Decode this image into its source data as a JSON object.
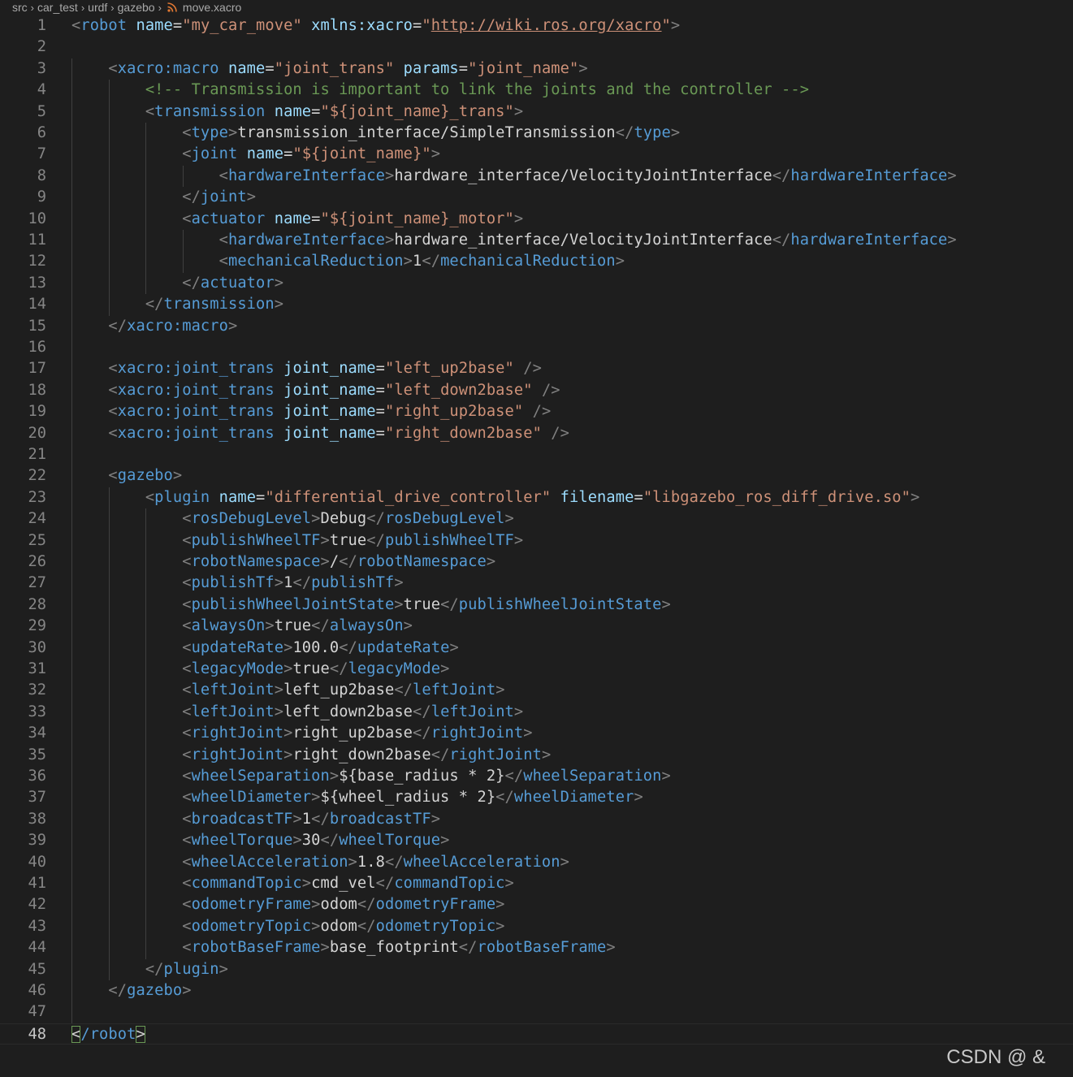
{
  "breadcrumb": {
    "items": [
      "src",
      "car_test",
      "urdf",
      "gazebo"
    ],
    "file": "move.xacro"
  },
  "editor": {
    "active_line": 48,
    "lines": [
      [
        [
          "p",
          "<"
        ],
        [
          "t",
          "robot"
        ],
        [
          "x",
          " "
        ],
        [
          "a",
          "name"
        ],
        [
          "x",
          "="
        ],
        [
          "s",
          "\"my_car_move\""
        ],
        [
          "x",
          " "
        ],
        [
          "a",
          "xmlns:xacro"
        ],
        [
          "x",
          "="
        ],
        [
          "s",
          "\""
        ],
        [
          "u",
          "http://wiki.ros.org/xacro"
        ],
        [
          "s",
          "\""
        ],
        [
          "p",
          ">"
        ]
      ],
      [],
      [
        [
          "x",
          "    "
        ],
        [
          "p",
          "<"
        ],
        [
          "t",
          "xacro:macro"
        ],
        [
          "x",
          " "
        ],
        [
          "a",
          "name"
        ],
        [
          "x",
          "="
        ],
        [
          "s",
          "\"joint_trans\""
        ],
        [
          "x",
          " "
        ],
        [
          "a",
          "params"
        ],
        [
          "x",
          "="
        ],
        [
          "s",
          "\"joint_name\""
        ],
        [
          "p",
          ">"
        ]
      ],
      [
        [
          "x",
          "        "
        ],
        [
          "c",
          "<!-- Transmission is important to link the joints and the controller -->"
        ]
      ],
      [
        [
          "x",
          "        "
        ],
        [
          "p",
          "<"
        ],
        [
          "t",
          "transmission"
        ],
        [
          "x",
          " "
        ],
        [
          "a",
          "name"
        ],
        [
          "x",
          "="
        ],
        [
          "s",
          "\"${joint_name}_trans\""
        ],
        [
          "p",
          ">"
        ]
      ],
      [
        [
          "x",
          "            "
        ],
        [
          "p",
          "<"
        ],
        [
          "t",
          "type"
        ],
        [
          "p",
          ">"
        ],
        [
          "x",
          "transmission_interface/SimpleTransmission"
        ],
        [
          "p",
          "</"
        ],
        [
          "t",
          "type"
        ],
        [
          "p",
          ">"
        ]
      ],
      [
        [
          "x",
          "            "
        ],
        [
          "p",
          "<"
        ],
        [
          "t",
          "joint"
        ],
        [
          "x",
          " "
        ],
        [
          "a",
          "name"
        ],
        [
          "x",
          "="
        ],
        [
          "s",
          "\"${joint_name}\""
        ],
        [
          "p",
          ">"
        ]
      ],
      [
        [
          "x",
          "                "
        ],
        [
          "p",
          "<"
        ],
        [
          "t",
          "hardwareInterface"
        ],
        [
          "p",
          ">"
        ],
        [
          "x",
          "hardware_interface/VelocityJointInterface"
        ],
        [
          "p",
          "</"
        ],
        [
          "t",
          "hardwareInterface"
        ],
        [
          "p",
          ">"
        ]
      ],
      [
        [
          "x",
          "            "
        ],
        [
          "p",
          "</"
        ],
        [
          "t",
          "joint"
        ],
        [
          "p",
          ">"
        ]
      ],
      [
        [
          "x",
          "            "
        ],
        [
          "p",
          "<"
        ],
        [
          "t",
          "actuator"
        ],
        [
          "x",
          " "
        ],
        [
          "a",
          "name"
        ],
        [
          "x",
          "="
        ],
        [
          "s",
          "\"${joint_name}_motor\""
        ],
        [
          "p",
          ">"
        ]
      ],
      [
        [
          "x",
          "                "
        ],
        [
          "p",
          "<"
        ],
        [
          "t",
          "hardwareInterface"
        ],
        [
          "p",
          ">"
        ],
        [
          "x",
          "hardware_interface/VelocityJointInterface"
        ],
        [
          "p",
          "</"
        ],
        [
          "t",
          "hardwareInterface"
        ],
        [
          "p",
          ">"
        ]
      ],
      [
        [
          "x",
          "                "
        ],
        [
          "p",
          "<"
        ],
        [
          "t",
          "mechanicalReduction"
        ],
        [
          "p",
          ">"
        ],
        [
          "x",
          "1"
        ],
        [
          "p",
          "</"
        ],
        [
          "t",
          "mechanicalReduction"
        ],
        [
          "p",
          ">"
        ]
      ],
      [
        [
          "x",
          "            "
        ],
        [
          "p",
          "</"
        ],
        [
          "t",
          "actuator"
        ],
        [
          "p",
          ">"
        ]
      ],
      [
        [
          "x",
          "        "
        ],
        [
          "p",
          "</"
        ],
        [
          "t",
          "transmission"
        ],
        [
          "p",
          ">"
        ]
      ],
      [
        [
          "x",
          "    "
        ],
        [
          "p",
          "</"
        ],
        [
          "t",
          "xacro:macro"
        ],
        [
          "p",
          ">"
        ]
      ],
      [],
      [
        [
          "x",
          "    "
        ],
        [
          "p",
          "<"
        ],
        [
          "t",
          "xacro:joint_trans"
        ],
        [
          "x",
          " "
        ],
        [
          "a",
          "joint_name"
        ],
        [
          "x",
          "="
        ],
        [
          "s",
          "\"left_up2base\""
        ],
        [
          "x",
          " "
        ],
        [
          "p",
          "/>"
        ]
      ],
      [
        [
          "x",
          "    "
        ],
        [
          "p",
          "<"
        ],
        [
          "t",
          "xacro:joint_trans"
        ],
        [
          "x",
          " "
        ],
        [
          "a",
          "joint_name"
        ],
        [
          "x",
          "="
        ],
        [
          "s",
          "\"left_down2base\""
        ],
        [
          "x",
          " "
        ],
        [
          "p",
          "/>"
        ]
      ],
      [
        [
          "x",
          "    "
        ],
        [
          "p",
          "<"
        ],
        [
          "t",
          "xacro:joint_trans"
        ],
        [
          "x",
          " "
        ],
        [
          "a",
          "joint_name"
        ],
        [
          "x",
          "="
        ],
        [
          "s",
          "\"right_up2base\""
        ],
        [
          "x",
          " "
        ],
        [
          "p",
          "/>"
        ]
      ],
      [
        [
          "x",
          "    "
        ],
        [
          "p",
          "<"
        ],
        [
          "t",
          "xacro:joint_trans"
        ],
        [
          "x",
          " "
        ],
        [
          "a",
          "joint_name"
        ],
        [
          "x",
          "="
        ],
        [
          "s",
          "\"right_down2base\""
        ],
        [
          "x",
          " "
        ],
        [
          "p",
          "/>"
        ]
      ],
      [],
      [
        [
          "x",
          "    "
        ],
        [
          "p",
          "<"
        ],
        [
          "t",
          "gazebo"
        ],
        [
          "p",
          ">"
        ]
      ],
      [
        [
          "x",
          "        "
        ],
        [
          "p",
          "<"
        ],
        [
          "t",
          "plugin"
        ],
        [
          "x",
          " "
        ],
        [
          "a",
          "name"
        ],
        [
          "x",
          "="
        ],
        [
          "s",
          "\"differential_drive_controller\""
        ],
        [
          "x",
          " "
        ],
        [
          "a",
          "filename"
        ],
        [
          "x",
          "="
        ],
        [
          "s",
          "\"libgazebo_ros_diff_drive.so\""
        ],
        [
          "p",
          ">"
        ]
      ],
      [
        [
          "x",
          "            "
        ],
        [
          "p",
          "<"
        ],
        [
          "t",
          "rosDebugLevel"
        ],
        [
          "p",
          ">"
        ],
        [
          "x",
          "Debug"
        ],
        [
          "p",
          "</"
        ],
        [
          "t",
          "rosDebugLevel"
        ],
        [
          "p",
          ">"
        ]
      ],
      [
        [
          "x",
          "            "
        ],
        [
          "p",
          "<"
        ],
        [
          "t",
          "publishWheelTF"
        ],
        [
          "p",
          ">"
        ],
        [
          "x",
          "true"
        ],
        [
          "p",
          "</"
        ],
        [
          "t",
          "publishWheelTF"
        ],
        [
          "p",
          ">"
        ]
      ],
      [
        [
          "x",
          "            "
        ],
        [
          "p",
          "<"
        ],
        [
          "t",
          "robotNamespace"
        ],
        [
          "p",
          ">"
        ],
        [
          "x",
          "/"
        ],
        [
          "p",
          "</"
        ],
        [
          "t",
          "robotNamespace"
        ],
        [
          "p",
          ">"
        ]
      ],
      [
        [
          "x",
          "            "
        ],
        [
          "p",
          "<"
        ],
        [
          "t",
          "publishTf"
        ],
        [
          "p",
          ">"
        ],
        [
          "x",
          "1"
        ],
        [
          "p",
          "</"
        ],
        [
          "t",
          "publishTf"
        ],
        [
          "p",
          ">"
        ]
      ],
      [
        [
          "x",
          "            "
        ],
        [
          "p",
          "<"
        ],
        [
          "t",
          "publishWheelJointState"
        ],
        [
          "p",
          ">"
        ],
        [
          "x",
          "true"
        ],
        [
          "p",
          "</"
        ],
        [
          "t",
          "publishWheelJointState"
        ],
        [
          "p",
          ">"
        ]
      ],
      [
        [
          "x",
          "            "
        ],
        [
          "p",
          "<"
        ],
        [
          "t",
          "alwaysOn"
        ],
        [
          "p",
          ">"
        ],
        [
          "x",
          "true"
        ],
        [
          "p",
          "</"
        ],
        [
          "t",
          "alwaysOn"
        ],
        [
          "p",
          ">"
        ]
      ],
      [
        [
          "x",
          "            "
        ],
        [
          "p",
          "<"
        ],
        [
          "t",
          "updateRate"
        ],
        [
          "p",
          ">"
        ],
        [
          "x",
          "100.0"
        ],
        [
          "p",
          "</"
        ],
        [
          "t",
          "updateRate"
        ],
        [
          "p",
          ">"
        ]
      ],
      [
        [
          "x",
          "            "
        ],
        [
          "p",
          "<"
        ],
        [
          "t",
          "legacyMode"
        ],
        [
          "p",
          ">"
        ],
        [
          "x",
          "true"
        ],
        [
          "p",
          "</"
        ],
        [
          "t",
          "legacyMode"
        ],
        [
          "p",
          ">"
        ]
      ],
      [
        [
          "x",
          "            "
        ],
        [
          "p",
          "<"
        ],
        [
          "t",
          "leftJoint"
        ],
        [
          "p",
          ">"
        ],
        [
          "x",
          "left_up2base"
        ],
        [
          "p",
          "</"
        ],
        [
          "t",
          "leftJoint"
        ],
        [
          "p",
          ">"
        ]
      ],
      [
        [
          "x",
          "            "
        ],
        [
          "p",
          "<"
        ],
        [
          "t",
          "leftJoint"
        ],
        [
          "p",
          ">"
        ],
        [
          "x",
          "left_down2base"
        ],
        [
          "p",
          "</"
        ],
        [
          "t",
          "leftJoint"
        ],
        [
          "p",
          ">"
        ]
      ],
      [
        [
          "x",
          "            "
        ],
        [
          "p",
          "<"
        ],
        [
          "t",
          "rightJoint"
        ],
        [
          "p",
          ">"
        ],
        [
          "x",
          "right_up2base"
        ],
        [
          "p",
          "</"
        ],
        [
          "t",
          "rightJoint"
        ],
        [
          "p",
          ">"
        ]
      ],
      [
        [
          "x",
          "            "
        ],
        [
          "p",
          "<"
        ],
        [
          "t",
          "rightJoint"
        ],
        [
          "p",
          ">"
        ],
        [
          "x",
          "right_down2base"
        ],
        [
          "p",
          "</"
        ],
        [
          "t",
          "rightJoint"
        ],
        [
          "p",
          ">"
        ]
      ],
      [
        [
          "x",
          "            "
        ],
        [
          "p",
          "<"
        ],
        [
          "t",
          "wheelSeparation"
        ],
        [
          "p",
          ">"
        ],
        [
          "x",
          "${base_radius * 2}"
        ],
        [
          "p",
          "</"
        ],
        [
          "t",
          "wheelSeparation"
        ],
        [
          "p",
          ">"
        ]
      ],
      [
        [
          "x",
          "            "
        ],
        [
          "p",
          "<"
        ],
        [
          "t",
          "wheelDiameter"
        ],
        [
          "p",
          ">"
        ],
        [
          "x",
          "${wheel_radius * 2}"
        ],
        [
          "p",
          "</"
        ],
        [
          "t",
          "wheelDiameter"
        ],
        [
          "p",
          ">"
        ]
      ],
      [
        [
          "x",
          "            "
        ],
        [
          "p",
          "<"
        ],
        [
          "t",
          "broadcastTF"
        ],
        [
          "p",
          ">"
        ],
        [
          "x",
          "1"
        ],
        [
          "p",
          "</"
        ],
        [
          "t",
          "broadcastTF"
        ],
        [
          "p",
          ">"
        ]
      ],
      [
        [
          "x",
          "            "
        ],
        [
          "p",
          "<"
        ],
        [
          "t",
          "wheelTorque"
        ],
        [
          "p",
          ">"
        ],
        [
          "x",
          "30"
        ],
        [
          "p",
          "</"
        ],
        [
          "t",
          "wheelTorque"
        ],
        [
          "p",
          ">"
        ]
      ],
      [
        [
          "x",
          "            "
        ],
        [
          "p",
          "<"
        ],
        [
          "t",
          "wheelAcceleration"
        ],
        [
          "p",
          ">"
        ],
        [
          "x",
          "1.8"
        ],
        [
          "p",
          "</"
        ],
        [
          "t",
          "wheelAcceleration"
        ],
        [
          "p",
          ">"
        ]
      ],
      [
        [
          "x",
          "            "
        ],
        [
          "p",
          "<"
        ],
        [
          "t",
          "commandTopic"
        ],
        [
          "p",
          ">"
        ],
        [
          "x",
          "cmd_vel"
        ],
        [
          "p",
          "</"
        ],
        [
          "t",
          "commandTopic"
        ],
        [
          "p",
          ">"
        ]
      ],
      [
        [
          "x",
          "            "
        ],
        [
          "p",
          "<"
        ],
        [
          "t",
          "odometryFrame"
        ],
        [
          "p",
          ">"
        ],
        [
          "x",
          "odom"
        ],
        [
          "p",
          "</"
        ],
        [
          "t",
          "odometryFrame"
        ],
        [
          "p",
          ">"
        ]
      ],
      [
        [
          "x",
          "            "
        ],
        [
          "p",
          "<"
        ],
        [
          "t",
          "odometryTopic"
        ],
        [
          "p",
          ">"
        ],
        [
          "x",
          "odom"
        ],
        [
          "p",
          "</"
        ],
        [
          "t",
          "odometryTopic"
        ],
        [
          "p",
          ">"
        ]
      ],
      [
        [
          "x",
          "            "
        ],
        [
          "p",
          "<"
        ],
        [
          "t",
          "robotBaseFrame"
        ],
        [
          "p",
          ">"
        ],
        [
          "x",
          "base_footprint"
        ],
        [
          "p",
          "</"
        ],
        [
          "t",
          "robotBaseFrame"
        ],
        [
          "p",
          ">"
        ]
      ],
      [
        [
          "x",
          "        "
        ],
        [
          "p",
          "</"
        ],
        [
          "t",
          "plugin"
        ],
        [
          "p",
          ">"
        ]
      ],
      [
        [
          "x",
          "    "
        ],
        [
          "p",
          "</"
        ],
        [
          "t",
          "gazebo"
        ],
        [
          "p",
          ">"
        ]
      ],
      [],
      [
        [
          "bm",
          "<"
        ],
        [
          "t",
          "/robot"
        ],
        [
          "bm",
          ">"
        ]
      ]
    ]
  },
  "watermark": "CSDN @    &",
  "colors": {
    "background": "#1e1e1e",
    "tag": "#569cd6",
    "attribute": "#9cdcfe",
    "string": "#ce9178",
    "comment": "#6a9955",
    "punctuation": "#808080",
    "text": "#d4d4d4"
  }
}
